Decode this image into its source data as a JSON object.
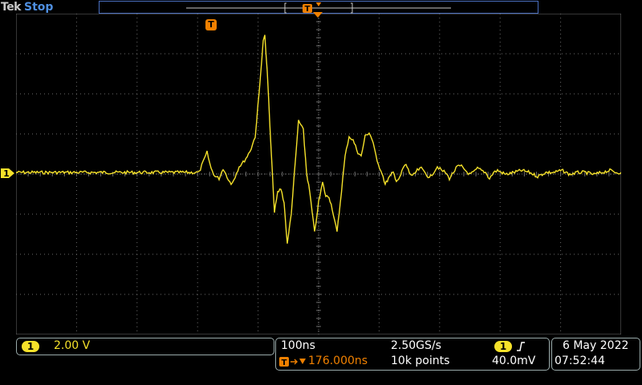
{
  "header": {
    "brand": "Tek",
    "run_state": "Stop",
    "trigger_marker_label": "T",
    "record_bar_label": "T"
  },
  "channel1": {
    "marker_label": "1",
    "badge": "1",
    "vertical_scale": "2.00 V"
  },
  "horizontal": {
    "time_per_div": "100ns",
    "sample_rate": "2.50GS/s",
    "trigger_delay": "176.000ns",
    "record_length": "10k points"
  },
  "trigger": {
    "source_badge": "1",
    "slope_icon": "rising-edge-icon",
    "level": "40.0mV"
  },
  "datetime": {
    "date": "6 May 2022",
    "time": "07:52:44"
  },
  "colors": {
    "waveform": "#f5e12a",
    "grid": "#6b6b6b",
    "trigger": "#f08000",
    "accent_blue": "#4f8fe0"
  },
  "waveform_samples": [
    [
      0,
      0
    ],
    [
      20,
      0
    ],
    [
      40,
      0
    ],
    [
      60,
      0
    ],
    [
      80,
      0
    ],
    [
      100,
      0
    ],
    [
      120,
      0
    ],
    [
      140,
      0
    ],
    [
      160,
      0
    ],
    [
      180,
      0
    ],
    [
      200,
      0
    ],
    [
      220,
      0
    ],
    [
      228,
      0
    ],
    [
      233,
      0.5
    ],
    [
      238,
      1.0
    ],
    [
      243,
      0.2
    ],
    [
      248,
      -0.2
    ],
    [
      253,
      -0.3
    ],
    [
      258,
      0.2
    ],
    [
      263,
      -0.2
    ],
    [
      268,
      -0.6
    ],
    [
      273,
      -0.2
    ],
    [
      278,
      0.3
    ],
    [
      283,
      0.5
    ],
    [
      288,
      0.8
    ],
    [
      293,
      1.2
    ],
    [
      298,
      1.8
    ],
    [
      303,
      4.0
    ],
    [
      308,
      6.6
    ],
    [
      310,
      6.8
    ],
    [
      313,
      5.0
    ],
    [
      318,
      1.0
    ],
    [
      322,
      -2.0
    ],
    [
      326,
      -1.0
    ],
    [
      330,
      -0.8
    ],
    [
      334,
      -1.5
    ],
    [
      338,
      -3.6
    ],
    [
      343,
      -2.0
    ],
    [
      348,
      0.5
    ],
    [
      352,
      2.6
    ],
    [
      358,
      2.1
    ],
    [
      362,
      0.0
    ],
    [
      366,
      -1.0
    ],
    [
      372,
      -3.0
    ],
    [
      377,
      -1.5
    ],
    [
      382,
      -0.5
    ],
    [
      386,
      -1.2
    ],
    [
      390,
      -1.2
    ],
    [
      394,
      -1.8
    ],
    [
      400,
      -3.0
    ],
    [
      404,
      -1.5
    ],
    [
      410,
      0.8
    ],
    [
      415,
      1.8
    ],
    [
      420,
      1.6
    ],
    [
      426,
      1.0
    ],
    [
      430,
      0.8
    ],
    [
      435,
      1.8
    ],
    [
      440,
      2.0
    ],
    [
      445,
      1.5
    ],
    [
      450,
      0.5
    ],
    [
      456,
      0.0
    ],
    [
      460,
      -0.6
    ],
    [
      464,
      -0.3
    ],
    [
      470,
      0.0
    ],
    [
      474,
      -0.4
    ],
    [
      478,
      -0.3
    ],
    [
      482,
      0.2
    ],
    [
      486,
      0.4
    ],
    [
      490,
      0.0
    ],
    [
      494,
      -0.2
    ],
    [
      500,
      0.1
    ],
    [
      505,
      0.2
    ],
    [
      510,
      0.0
    ],
    [
      515,
      -0.3
    ],
    [
      520,
      0.0
    ],
    [
      525,
      0.3
    ],
    [
      530,
      0.1
    ],
    [
      535,
      0.0
    ],
    [
      540,
      -0.3
    ],
    [
      545,
      0.0
    ],
    [
      550,
      0.3
    ],
    [
      555,
      0.3
    ],
    [
      560,
      0.1
    ],
    [
      565,
      -0.1
    ],
    [
      570,
      0.0
    ],
    [
      575,
      0.2
    ],
    [
      580,
      0.1
    ],
    [
      585,
      0.0
    ],
    [
      590,
      -0.3
    ],
    [
      595,
      0.0
    ],
    [
      600,
      0.1
    ],
    [
      610,
      -0.1
    ],
    [
      620,
      0.0
    ],
    [
      630,
      0.1
    ],
    [
      640,
      0.0
    ],
    [
      650,
      -0.2
    ],
    [
      660,
      0.0
    ],
    [
      670,
      0.0
    ],
    [
      680,
      0.1
    ],
    [
      690,
      -0.1
    ],
    [
      700,
      0.0
    ],
    [
      710,
      0.0
    ],
    [
      720,
      -0.1
    ],
    [
      730,
      0.0
    ],
    [
      740,
      0.1
    ],
    [
      748,
      0.0
    ],
    [
      754,
      0.0
    ]
  ]
}
